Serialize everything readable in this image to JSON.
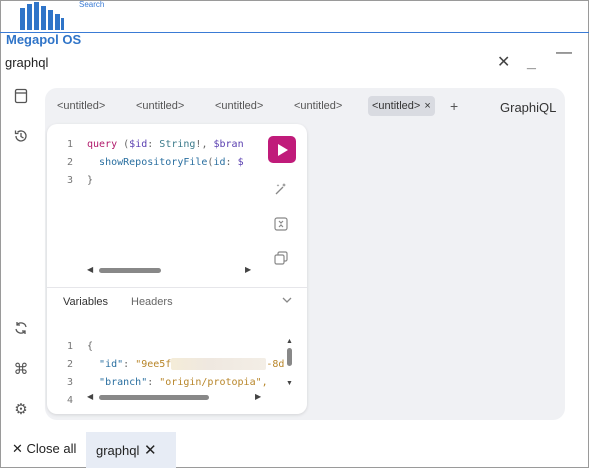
{
  "header": {
    "search_label": "Search",
    "brand": "Megapol OS",
    "brand_color": "#2f74c8"
  },
  "window": {
    "title": "graphql",
    "close_icon": "✕",
    "minimize_icon": "_",
    "maximize_icon": "—"
  },
  "sidebar": {
    "icons": [
      "book-icon",
      "history-icon",
      "refresh-icon",
      "command-icon",
      "gear-icon"
    ]
  },
  "graphiql": {
    "tabs": [
      {
        "label": "<untitled>",
        "active": false
      },
      {
        "label": "<untitled>",
        "active": false
      },
      {
        "label": "<untitled>",
        "active": false
      },
      {
        "label": "<untitled>",
        "active": false
      },
      {
        "label": "<untitled>",
        "active": true
      }
    ],
    "active_tab_close": "×",
    "add_tab": "+",
    "logo": "GraphiQL",
    "query_lines": [
      {
        "num": "1",
        "text": "query ($id: String!, $bran"
      },
      {
        "num": "2",
        "text": "  showRepositoryFile(id: $"
      },
      {
        "num": "3",
        "text": "}"
      }
    ],
    "variables_tab": "Variables",
    "headers_tab": "Headers",
    "variable_lines": [
      {
        "num": "1",
        "text": "{"
      },
      {
        "num": "2",
        "key": "\"id\"",
        "value_start": "\"9ee5f",
        "value_end": "-8d"
      },
      {
        "num": "3",
        "key": "\"branch\"",
        "value": "\"origin/protopia\","
      },
      {
        "num": "4",
        "text": ""
      }
    ],
    "accent_color": "#c01b7a"
  },
  "bottom": {
    "close_all": "Close all",
    "tab_label": "graphql"
  }
}
